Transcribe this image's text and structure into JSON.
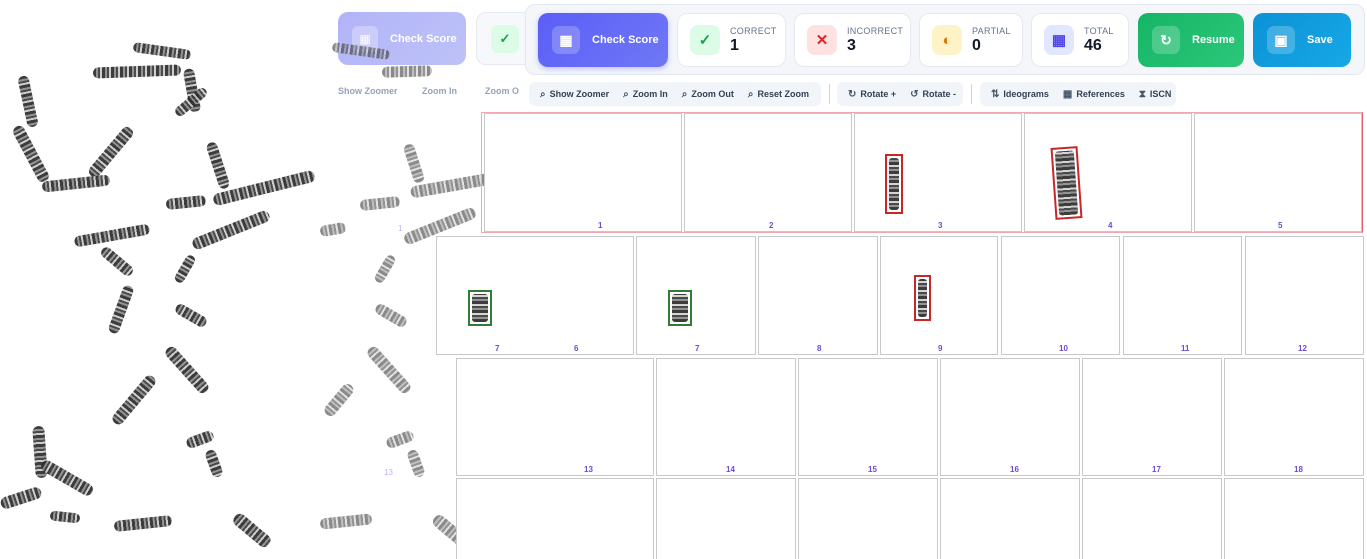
{
  "score_panel": {
    "check_score_label": "Check Score",
    "correct": {
      "label": "CORRECT",
      "value": "1"
    },
    "incorrect": {
      "label": "INCORRECT",
      "value": "3"
    },
    "partial": {
      "label": "PARTIAL",
      "value": "0"
    },
    "total": {
      "label": "TOTAL",
      "value": "46"
    },
    "resume_label": "Resume",
    "save_label": "Save"
  },
  "toolbar": {
    "show_zoomer": "Show Zoomer",
    "zoom_in": "Zoom In",
    "zoom_out": "Zoom Out",
    "reset_zoom": "Reset Zoom",
    "rotate_plus": "Rotate +",
    "rotate_minus": "Rotate -",
    "ideograms": "Ideograms",
    "references": "References",
    "iscn": "ISCN"
  },
  "ghost": {
    "check_score_label": "Check Score",
    "show_zoomer": "Show Zoomer",
    "zoom_in": "Zoom In",
    "zoom_out": "Zoom O"
  },
  "karyotype": {
    "row1": [
      "1",
      "2",
      "3",
      "4",
      "5"
    ],
    "row2": [
      "6",
      "7",
      "8",
      "9",
      "10",
      "11",
      "12"
    ],
    "row3": [
      "13",
      "14",
      "15",
      "16",
      "17",
      "18"
    ],
    "row2_placed_label": "7",
    "ghost_labels": [
      "1",
      "13"
    ]
  },
  "colors": {
    "primary": "#5b5ef7",
    "correct": "#16a34a",
    "incorrect": "#dc2626",
    "partial": "#d97706",
    "resume": "#16b566",
    "save": "#0b92d6",
    "cell_label": "#6d4ad6"
  }
}
